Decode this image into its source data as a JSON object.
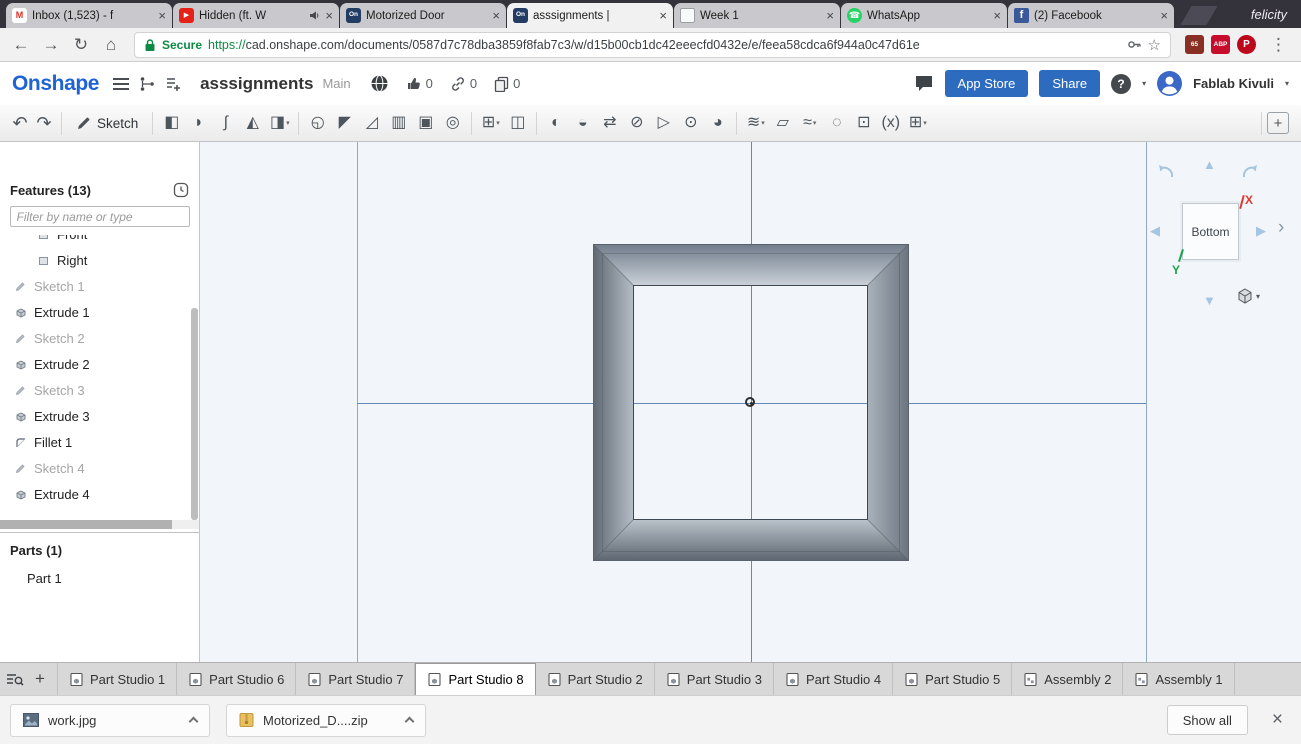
{
  "window": {
    "host_label": "felicity"
  },
  "colors": {
    "onshape_logo_blue": "#1e63d6",
    "accent_button_blue": "#2d6bbf",
    "secure_green": "#0e8a44",
    "axis_x_red": "#e03a2f",
    "axis_y_green": "#1ea24d",
    "plane_line_blue": "#6289ba"
  },
  "icons": {
    "back": "←",
    "forward": "→",
    "reload": "↻",
    "home": "⌂",
    "star": "☆",
    "menu": "⋮",
    "undo": "↶",
    "redo": "↷",
    "caret_down": "▾",
    "plus": "+",
    "close": "×",
    "help": "?",
    "up_triangle": "▲",
    "down_triangle": "▼",
    "left_triangle": "◀",
    "right_triangle": "▶",
    "chevron_right": "›"
  },
  "favicons": {
    "gmail": {
      "glyph": "M",
      "bg": "#ffffff",
      "fg": "#d93025",
      "radius": "3px",
      "size": "9px"
    },
    "youtube": {
      "glyph": "▶",
      "bg": "#e62117",
      "fg": "#ffffff",
      "radius": "3px",
      "size": "7px"
    },
    "onshape": {
      "glyph": "On",
      "bg": "#233c63",
      "fg": "#ffffff",
      "radius": "3px",
      "size": "6.5px"
    },
    "doc": {
      "glyph": "",
      "bg": "#f8f9fa",
      "fg": "#5f6368",
      "radius": "2px",
      "size": "8px",
      "border": "1px solid #9aa0a6"
    },
    "whatsapp": {
      "glyph": "☎",
      "bg": "#25d366",
      "fg": "#ffffff",
      "radius": "50%",
      "size": "9px"
    },
    "facebook": {
      "glyph": "f",
      "bg": "#3b5998",
      "fg": "#ffffff",
      "radius": "2px",
      "size": "11px"
    }
  },
  "browser": {
    "tabs": [
      {
        "label": "Inbox (1,523) - f",
        "favicon": "gmail",
        "active": false,
        "audio": false
      },
      {
        "label": "Hidden (ft. W",
        "favicon": "youtube",
        "active": false,
        "audio": true
      },
      {
        "label": "Motorized Door",
        "favicon": "onshape",
        "active": false,
        "audio": false
      },
      {
        "label": "asssignments | ",
        "favicon": "onshape",
        "active": true,
        "audio": false
      },
      {
        "label": "Week 1",
        "favicon": "doc",
        "active": false,
        "audio": false
      },
      {
        "label": "WhatsApp",
        "favicon": "whatsapp",
        "active": false,
        "audio": false
      },
      {
        "label": "(2) Facebook",
        "favicon": "facebook",
        "active": false,
        "audio": false
      }
    ],
    "secure_label": "Secure",
    "url_scheme": "https://",
    "url_rest": "cad.onshape.com/documents/0587d7c78dba3859f8fab7c3/w/d15b00cb1dc42eeecfd0432e/e/feea58cdca6f944a0c47d61e",
    "extensions": [
      {
        "name": "extension-badge-icon",
        "text": "65",
        "color": "#8a2f23",
        "shape": "square"
      },
      {
        "name": "adblock-icon",
        "text": "ABP",
        "color": "#c70d2c",
        "shape": "square"
      },
      {
        "name": "pinterest-icon",
        "text": "P",
        "color": "#bd081c",
        "shape": "circle"
      }
    ]
  },
  "app_header": {
    "logo_text": "Onshape",
    "doc_title": "asssignments",
    "workspace_label": "Main",
    "like_count": "0",
    "link_count": "0",
    "copy_count": "0",
    "app_store_label": "App Store",
    "share_label": "Share",
    "user_name": "Fablab Kivuli"
  },
  "cad_toolbar": {
    "sketch_label": "Sketch",
    "tools": [
      {
        "name": "extrude-icon",
        "glyph": "◧"
      },
      {
        "name": "revolve-icon",
        "glyph": "◗"
      },
      {
        "name": "sweep-icon",
        "glyph": "∫"
      },
      {
        "name": "loft-icon",
        "glyph": "◭"
      },
      {
        "name": "thicken-icon",
        "glyph": "◨",
        "caret": true
      },
      {
        "sep": true
      },
      {
        "name": "fillet-icon",
        "glyph": "◵"
      },
      {
        "name": "chamfer-icon",
        "glyph": "◤"
      },
      {
        "name": "draft-icon",
        "glyph": "◿"
      },
      {
        "name": "rib-icon",
        "glyph": "▥"
      },
      {
        "name": "shell-icon",
        "glyph": "▣"
      },
      {
        "name": "hole-icon",
        "glyph": "◎"
      },
      {
        "sep": true
      },
      {
        "name": "linear-pattern-icon",
        "glyph": "⊞",
        "caret": true
      },
      {
        "name": "mirror-icon",
        "glyph": "◫"
      },
      {
        "sep": true
      },
      {
        "name": "boolean-icon",
        "glyph": "◐"
      },
      {
        "name": "split-icon",
        "glyph": "◒"
      },
      {
        "name": "transform-icon",
        "glyph": "⇄"
      },
      {
        "name": "delete-part-icon",
        "glyph": "⊘"
      },
      {
        "name": "move-face-icon",
        "glyph": "▷"
      },
      {
        "name": "replace-face-icon",
        "glyph": "⊙"
      },
      {
        "name": "modify-fillet-icon",
        "glyph": "◕"
      },
      {
        "sep": true
      },
      {
        "name": "offset-surface-icon",
        "glyph": "≋",
        "caret": true
      },
      {
        "name": "plane-icon",
        "glyph": "▱"
      },
      {
        "name": "curve-icon",
        "glyph": "≈",
        "caret": true
      },
      {
        "name": "helix-icon",
        "glyph": "◌"
      },
      {
        "name": "derived-icon",
        "glyph": "⊡"
      },
      {
        "name": "variable-icon",
        "glyph": "(x)"
      },
      {
        "name": "featurescript-icon",
        "glyph": "⊞",
        "caret": true
      },
      {
        "sep": true,
        "push": true
      },
      {
        "name": "add-custom-tool-icon",
        "glyph": "+",
        "boxed": true
      }
    ]
  },
  "features_panel": {
    "title": "Features (13)",
    "filter_placeholder": "Filter by name or type",
    "items": [
      {
        "label": "Front",
        "type": "plane",
        "clipped": true
      },
      {
        "label": "Right",
        "type": "plane"
      },
      {
        "label": "Sketch 1",
        "type": "sketch",
        "muted": true
      },
      {
        "label": "Extrude 1",
        "type": "extrude"
      },
      {
        "label": "Sketch 2",
        "type": "sketch",
        "muted": true
      },
      {
        "label": "Extrude 2",
        "type": "extrude"
      },
      {
        "label": "Sketch 3",
        "type": "sketch",
        "muted": true
      },
      {
        "label": "Extrude 3",
        "type": "extrude"
      },
      {
        "label": "Fillet 1",
        "type": "fillet"
      },
      {
        "label": "Sketch 4",
        "type": "sketch",
        "muted": true
      },
      {
        "label": "Extrude 4",
        "type": "extrude"
      }
    ],
    "parts_title": "Parts (1)",
    "parts": [
      {
        "label": "Part 1"
      }
    ]
  },
  "viewport": {
    "view_label": "Bottom",
    "axis_x": "X",
    "axis_y": "Y"
  },
  "tab_bar": {
    "tabs": [
      {
        "label": "Part Studio 1",
        "kind": "part",
        "active": false
      },
      {
        "label": "Part Studio 6",
        "kind": "part",
        "active": false
      },
      {
        "label": "Part Studio 7",
        "kind": "part",
        "active": false
      },
      {
        "label": "Part Studio 8",
        "kind": "part",
        "active": true
      },
      {
        "label": "Part Studio 2",
        "kind": "part",
        "active": false
      },
      {
        "label": "Part Studio 3",
        "kind": "part",
        "active": false
      },
      {
        "label": "Part Studio 4",
        "kind": "part",
        "active": false
      },
      {
        "label": "Part Studio 5",
        "kind": "part",
        "active": false
      },
      {
        "label": "Assembly 2",
        "kind": "assembly",
        "active": false
      },
      {
        "label": "Assembly 1",
        "kind": "assembly",
        "active": false
      }
    ]
  },
  "downloads": {
    "items": [
      {
        "label": "work.jpg",
        "kind": "image"
      },
      {
        "label": "Motorized_D....zip",
        "kind": "zip"
      }
    ],
    "show_all_label": "Show all"
  }
}
